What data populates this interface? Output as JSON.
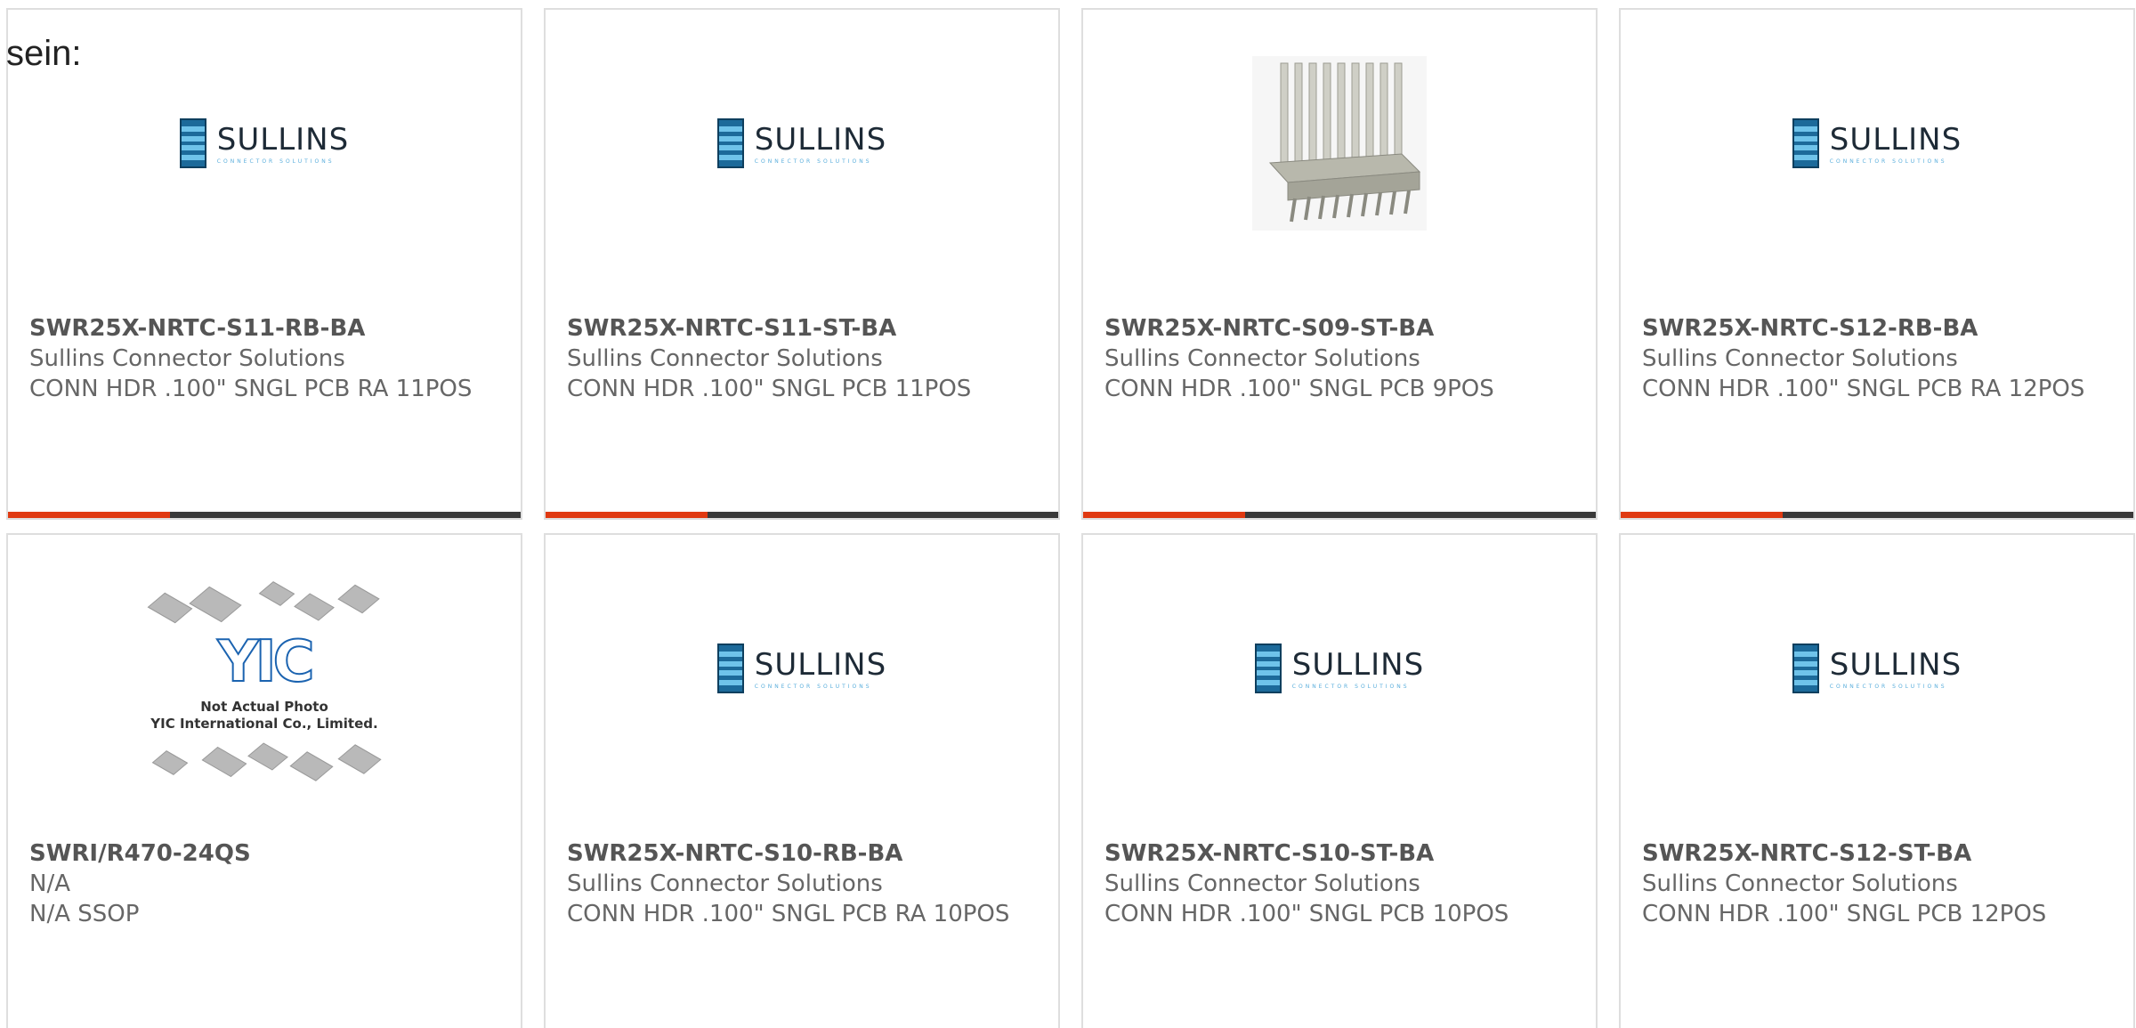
{
  "intro_text": "sein:",
  "colors": {
    "accent": "#e03a12",
    "bar": "#3a3a3a",
    "border": "#dedede",
    "sullins_blue": "#1c6a9a"
  },
  "products": [
    {
      "part_number": "SWR25X-NRTC-S11-RB-BA",
      "manufacturer": "Sullins Connector Solutions",
      "description": "CONN HDR .100\" SNGL PCB RA 11POS",
      "image": "sullins-logo"
    },
    {
      "part_number": "SWR25X-NRTC-S11-ST-BA",
      "manufacturer": "Sullins Connector Solutions",
      "description": "CONN HDR .100\" SNGL PCB 11POS",
      "image": "sullins-logo"
    },
    {
      "part_number": "SWR25X-NRTC-S09-ST-BA",
      "manufacturer": "Sullins Connector Solutions",
      "description": "CONN HDR .100\" SNGL PCB 9POS",
      "image": "connector-photo"
    },
    {
      "part_number": "SWR25X-NRTC-S12-RB-BA",
      "manufacturer": "Sullins Connector Solutions",
      "description": "CONN HDR .100\" SNGL PCB RA 12POS",
      "image": "sullins-logo"
    },
    {
      "part_number": "SWRI/R470-24QS",
      "manufacturer": "N/A",
      "description": "N/A SSOP",
      "image": "yic-placeholder"
    },
    {
      "part_number": "SWR25X-NRTC-S10-RB-BA",
      "manufacturer": "Sullins Connector Solutions",
      "description": "CONN HDR .100\" SNGL PCB RA 10POS",
      "image": "sullins-logo"
    },
    {
      "part_number": "SWR25X-NRTC-S10-ST-BA",
      "manufacturer": "Sullins Connector Solutions",
      "description": "CONN HDR .100\" SNGL PCB 10POS",
      "image": "sullins-logo"
    },
    {
      "part_number": "SWR25X-NRTC-S12-ST-BA",
      "manufacturer": "Sullins Connector Solutions",
      "description": "CONN HDR .100\" SNGL PCB 12POS",
      "image": "sullins-logo"
    }
  ],
  "sullins_logo": {
    "word": "SULLINS",
    "tagline": "CONNECTOR SOLUTIONS"
  },
  "yic_placeholder": {
    "logo_text": "YIC",
    "note_line1": "Not Actual Photo",
    "note_line2": "YIC International Co., Limited."
  }
}
